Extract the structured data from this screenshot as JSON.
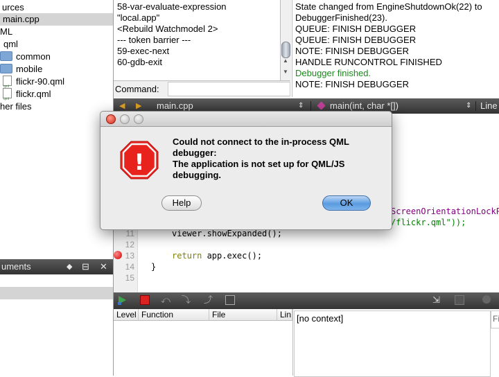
{
  "tree": {
    "items": [
      {
        "label": "urces"
      },
      {
        "label": "main.cpp"
      },
      {
        "label": "ML"
      },
      {
        "label": "qml"
      },
      {
        "label": "common"
      },
      {
        "label": "mobile"
      },
      {
        "label": "flickr-90.qml"
      },
      {
        "label": "flickr.qml"
      },
      {
        "label": "her files"
      }
    ]
  },
  "stack_panel": {
    "title": "uments",
    "split_glyph": "⊟",
    "close_glyph": "✕"
  },
  "log": {
    "lines": [
      "58-var-evaluate-expression",
      "\"local.app\"",
      "<Rebuild Watchmodel 2>",
      "--- token barrier ---",
      "59-exec-next",
      "60-gdb-exit"
    ],
    "command_label": "Command:"
  },
  "output": {
    "lines": [
      {
        "text": "State changed from EngineShutdownOk(22) to",
        "color": "#000000"
      },
      {
        "text": "DebuggerFinished(23).",
        "color": "#000000"
      },
      {
        "text": "QUEUE: FINISH DEBUGGER",
        "color": "#000000"
      },
      {
        "text": "QUEUE: FINISH DEBUGGER",
        "color": "#000000"
      },
      {
        "text": "NOTE: FINISH DEBUGGER",
        "color": "#000000"
      },
      {
        "text": "HANDLE RUNCONTROL FINISHED",
        "color": "#000000"
      },
      {
        "text": "Debugger finished.",
        "color": "#1a8a1a"
      },
      {
        "text": "NOTE: FINISH DEBUGGER",
        "color": "#000000"
      }
    ]
  },
  "editor": {
    "file_name": "main.cpp",
    "function_name": "main(int, char *[])",
    "line_label": "Line",
    "line_numbers": [
      "11",
      "12",
      "13",
      "14",
      "15"
    ],
    "code_lines": [
      {
        "keyword": "",
        "text": "viewer.showExpanded();"
      },
      {
        "keyword": "",
        "text": ""
      },
      {
        "keyword": "return",
        "text": " app.exec();"
      },
      {
        "keyword": "",
        "text": "}"
      },
      {
        "keyword": "",
        "text": ""
      }
    ],
    "right_fragment_1": "ScreenOrientationLockP",
    "right_fragment_2": "/flickr.qml\"));"
  },
  "stack_table": {
    "columns": [
      "Level",
      "Function",
      "File",
      "Lin"
    ]
  },
  "context": {
    "text": "[no context]",
    "filter_fragment": "Fi"
  },
  "dialog": {
    "message": [
      "Could not connect to the in-process QML",
      "debugger:",
      "The application is not set up for QML/JS",
      "debugging."
    ],
    "help_label": "Help",
    "ok_label": "OK",
    "warning_glyph": "!"
  },
  "colors": {
    "accent_blue": "#5a9be0",
    "keyword": "#808000",
    "purple": "#800080",
    "green_text": "#1a8a1a",
    "stop_red": "#ee1111"
  }
}
